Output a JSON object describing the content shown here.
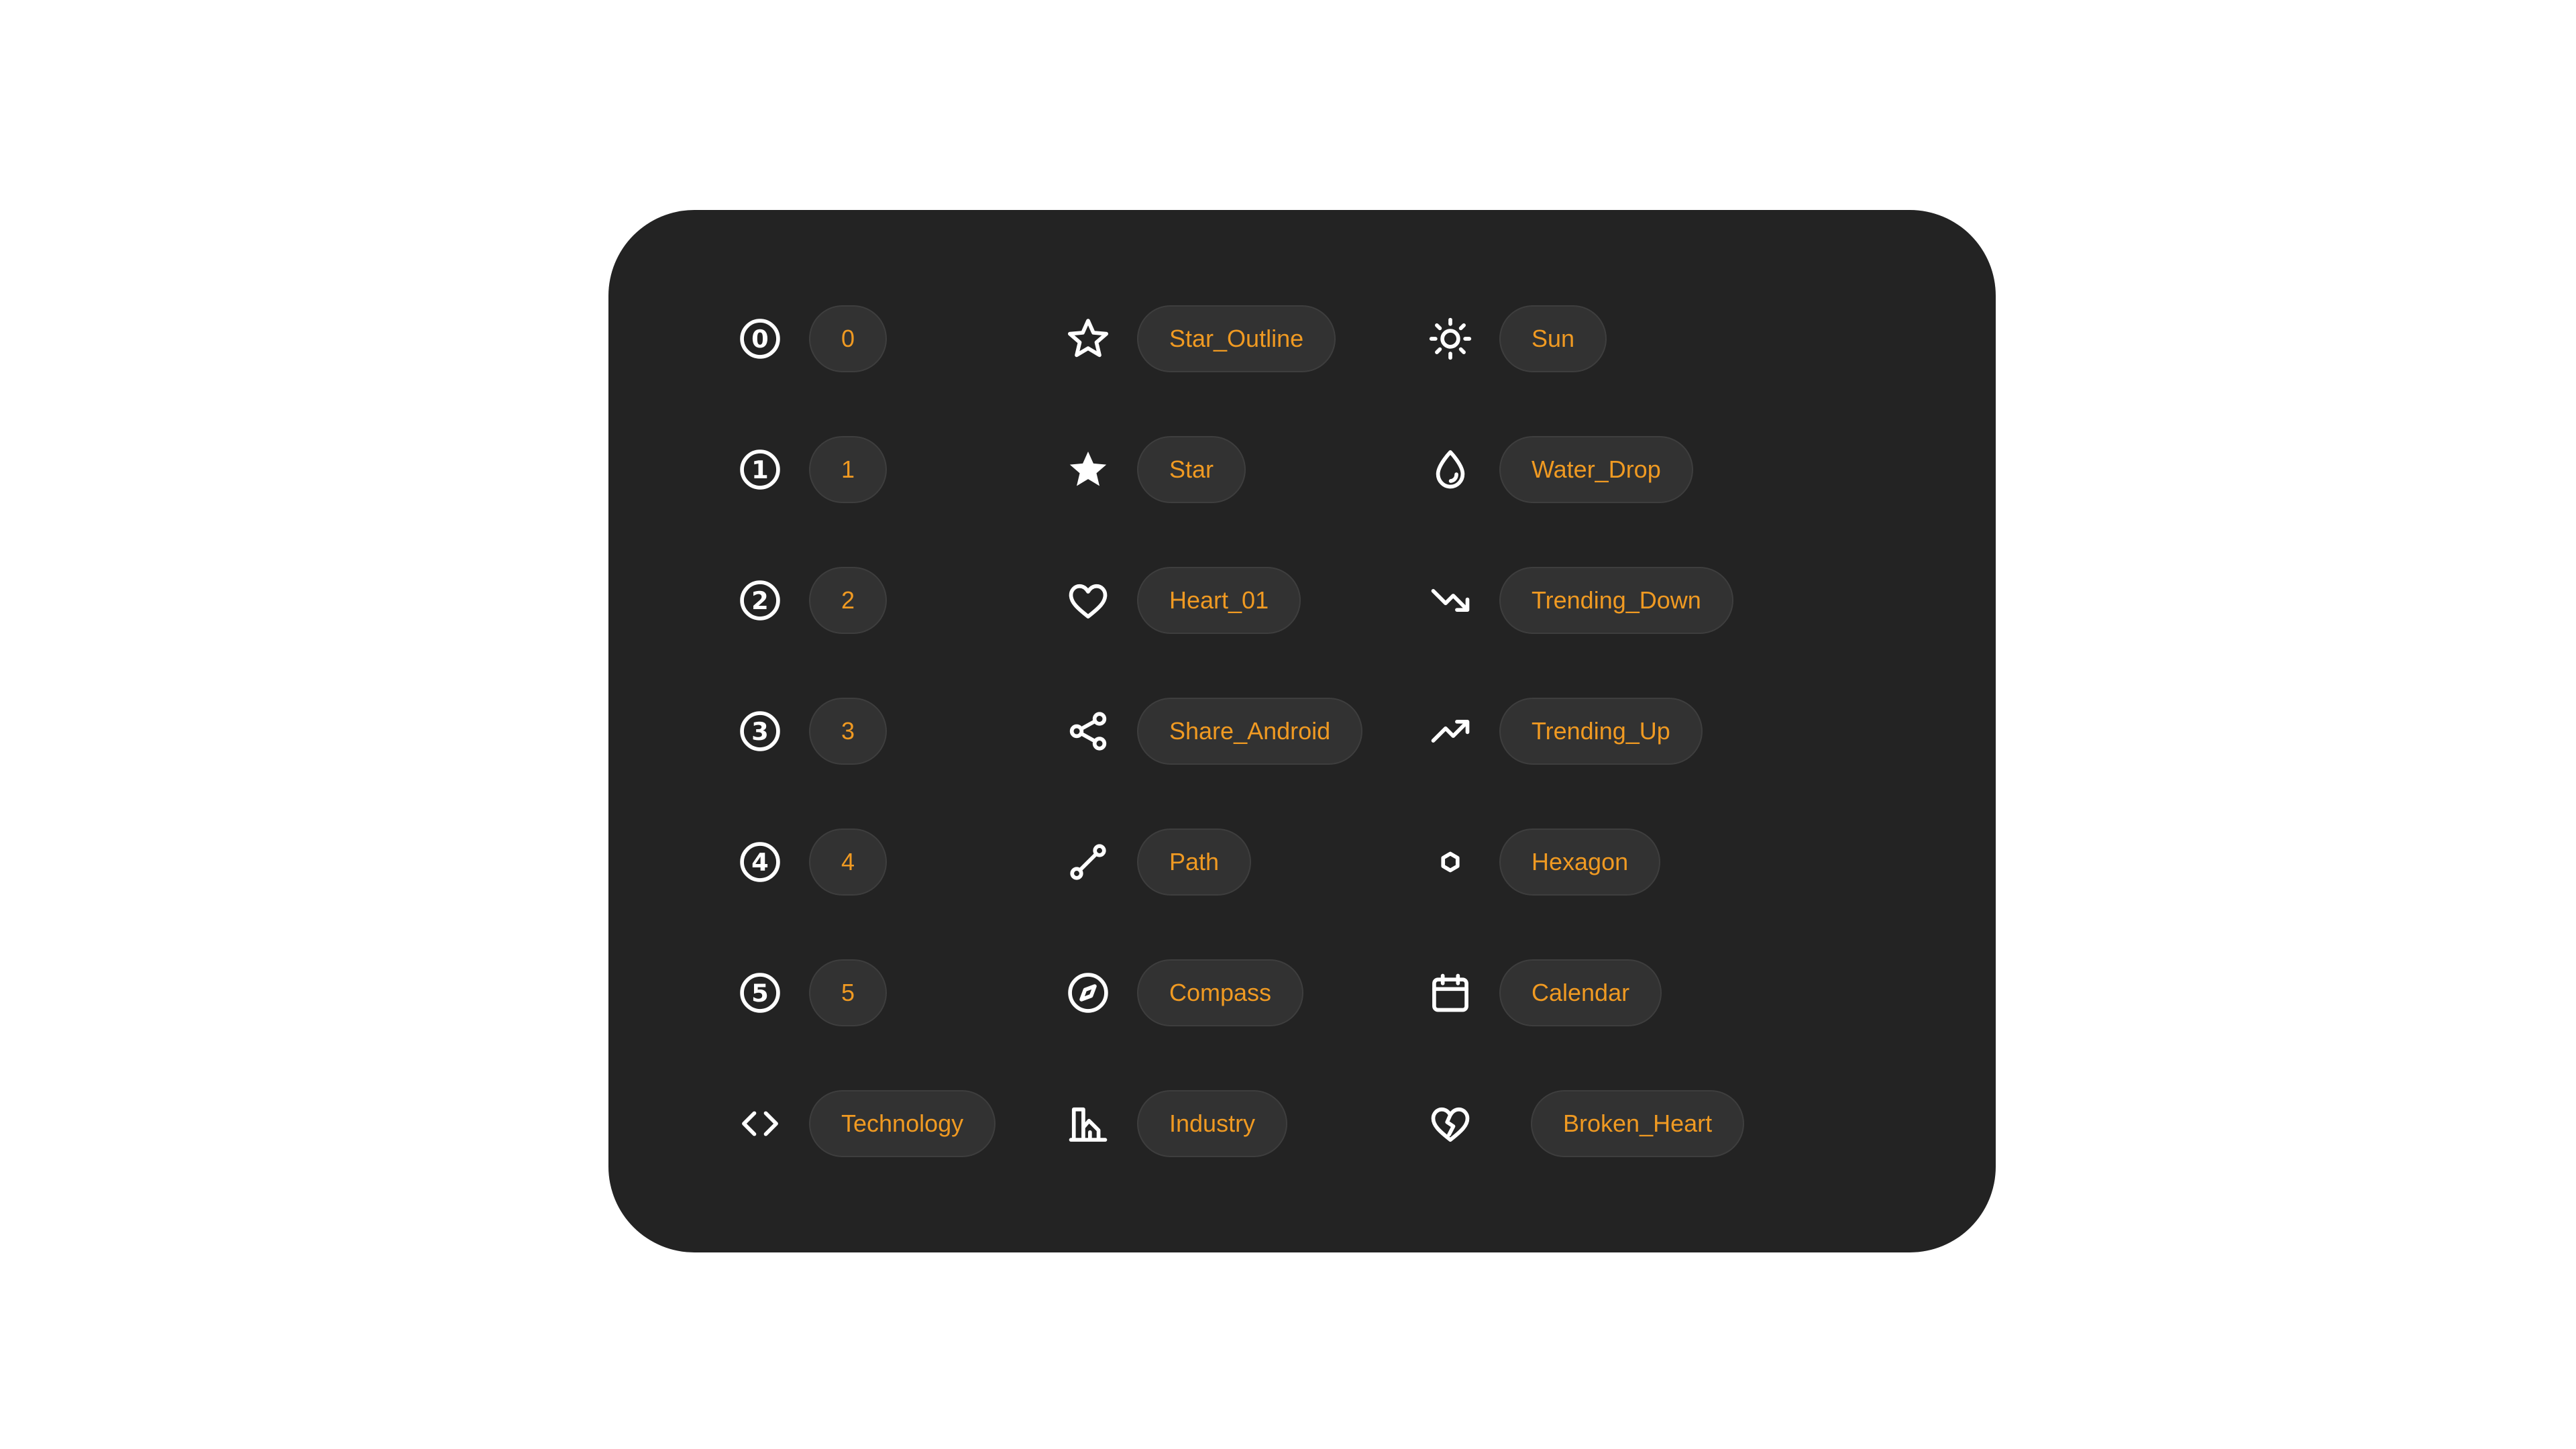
{
  "icon_grid": {
    "columns": [
      {
        "items": [
          {
            "icon": "circled-digit-0-icon",
            "label": "0"
          },
          {
            "icon": "circled-digit-1-icon",
            "label": "1"
          },
          {
            "icon": "circled-digit-2-icon",
            "label": "2"
          },
          {
            "icon": "circled-digit-3-icon",
            "label": "3"
          },
          {
            "icon": "circled-digit-4-icon",
            "label": "4"
          },
          {
            "icon": "circled-digit-5-icon",
            "label": "5"
          },
          {
            "icon": "code-brackets-icon",
            "label": "Technology"
          }
        ]
      },
      {
        "items": [
          {
            "icon": "star-outline-icon",
            "label": "Star_Outline"
          },
          {
            "icon": "star-icon",
            "label": "Star"
          },
          {
            "icon": "heart-icon",
            "label": "Heart_01"
          },
          {
            "icon": "share-android-icon",
            "label": "Share_Android"
          },
          {
            "icon": "path-icon",
            "label": "Path"
          },
          {
            "icon": "compass-icon",
            "label": "Compass"
          },
          {
            "icon": "industry-icon",
            "label": "Industry"
          }
        ]
      },
      {
        "items": [
          {
            "icon": "sun-icon",
            "label": "Sun"
          },
          {
            "icon": "water-drop-icon",
            "label": "Water_Drop"
          },
          {
            "icon": "trending-down-icon",
            "label": "Trending_Down"
          },
          {
            "icon": "trending-up-icon",
            "label": "Trending_Up"
          },
          {
            "icon": "hexagon-icon",
            "label": "Hexagon"
          },
          {
            "icon": "calendar-icon",
            "label": "Calendar"
          },
          {
            "icon": "broken-heart-icon",
            "label": "Broken_Heart"
          }
        ]
      }
    ]
  },
  "colors": {
    "page_background": "#ffffff",
    "card_background": "#232323",
    "chip_background": "#323232",
    "chip_border": "#3e3e3e",
    "chip_text": "#f09a22",
    "icon": "#ffffff"
  }
}
